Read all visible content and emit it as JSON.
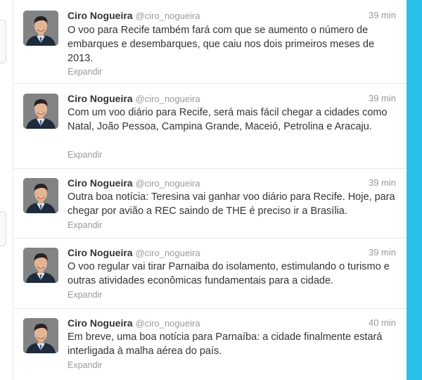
{
  "timeline": {
    "tweets": [
      {
        "fullname": "Ciro Nogueira",
        "username": "@ciro_nogueira",
        "time": "39 min",
        "text": "O voo para Recife também fará com que se aumento o número de embarques e desembarques, que caiu nos dois primeiros meses de 2013.",
        "expand": "Expandir"
      },
      {
        "fullname": "Ciro Nogueira",
        "username": "@ciro_nogueira",
        "time": "39 min",
        "text": "Com um voo diário para Recife, será mais fácil chegar a cidades como Natal, João Pessoa, Campina Grande, Maceió, Petrolina e Aracaju.",
        "expand": "Expandir"
      },
      {
        "fullname": "Ciro Nogueira",
        "username": "@ciro_nogueira",
        "time": "39 min",
        "text": "Outra boa notícia: Teresina vai ganhar voo diário para Recife. Hoje, para chegar por avião a REC saindo de THE é preciso ir a Brasília.",
        "expand": "Expandir"
      },
      {
        "fullname": "Ciro Nogueira",
        "username": "@ciro_nogueira",
        "time": "39 min",
        "text": "O voo regular vai tirar Parnaiba do isolamento, estimulando o turismo e outras atividades econômicas fundamentais para a cidade.",
        "expand": "Expandir"
      },
      {
        "fullname": "Ciro Nogueira",
        "username": "@ciro_nogueira",
        "time": "40 min",
        "text": "Em breve, uma boa notícia para Parnaíba: a cidade finalmente estará interligada à malha aérea do país.",
        "expand": "Expandir"
      }
    ]
  },
  "colors": {
    "right_bar": "#29c0ea",
    "name": "#333333",
    "muted": "#999999"
  }
}
